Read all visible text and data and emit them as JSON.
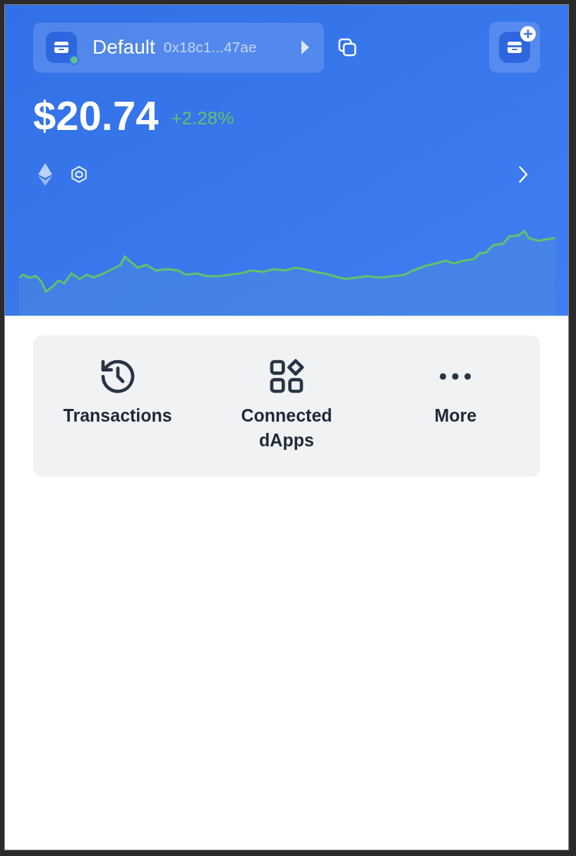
{
  "account": {
    "name": "Default",
    "address": "0x18c1...47ae",
    "connected": true
  },
  "balance": {
    "value": "$20.74",
    "change": "+2.28%"
  },
  "actions": [
    {
      "kind": "history",
      "label": "Transactions"
    },
    {
      "kind": "apps",
      "label": "Connected dApps"
    },
    {
      "kind": "more",
      "label": "More"
    }
  ]
}
